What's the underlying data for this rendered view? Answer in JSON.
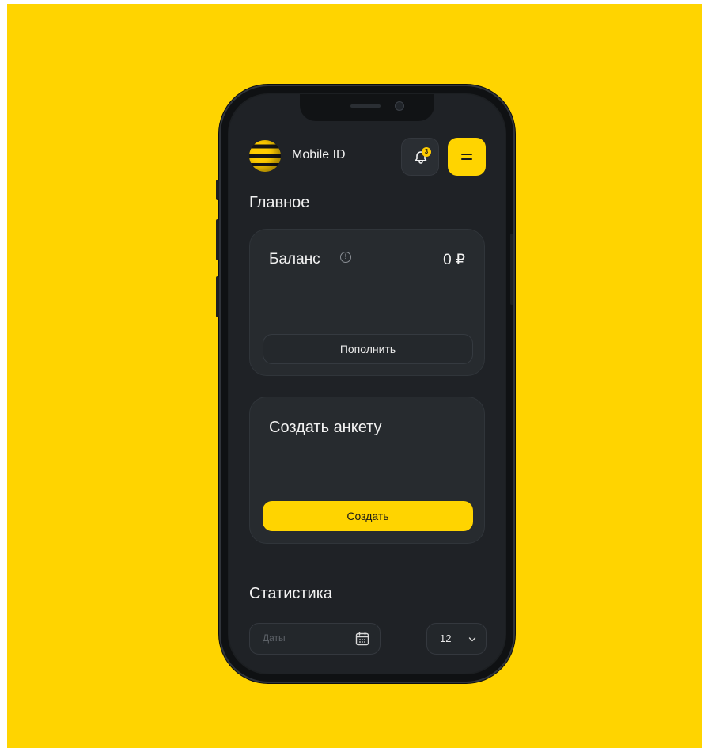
{
  "header": {
    "app_name": "Mobile ID",
    "notification_count": "3"
  },
  "main": {
    "section_title": "Главное",
    "balance_card": {
      "label": "Баланс",
      "info_glyph": "!",
      "value": "0 ₽",
      "topup_label": "Пополнить"
    },
    "form_card": {
      "title": "Создать анкету",
      "create_label": "Создать"
    }
  },
  "statistics": {
    "title": "Статистика",
    "date_placeholder": "Даты",
    "count_value": "12"
  },
  "colors": {
    "background": "#ffd400",
    "accent": "#ffd400",
    "surface": "#1f2226",
    "card": "#272b2f"
  },
  "icons": {
    "logo": "beeline-logo",
    "bell": "bell-icon",
    "menu": "menu-icon",
    "info": "info-icon",
    "calendar": "calendar-icon",
    "chevron": "chevron-down-icon"
  }
}
